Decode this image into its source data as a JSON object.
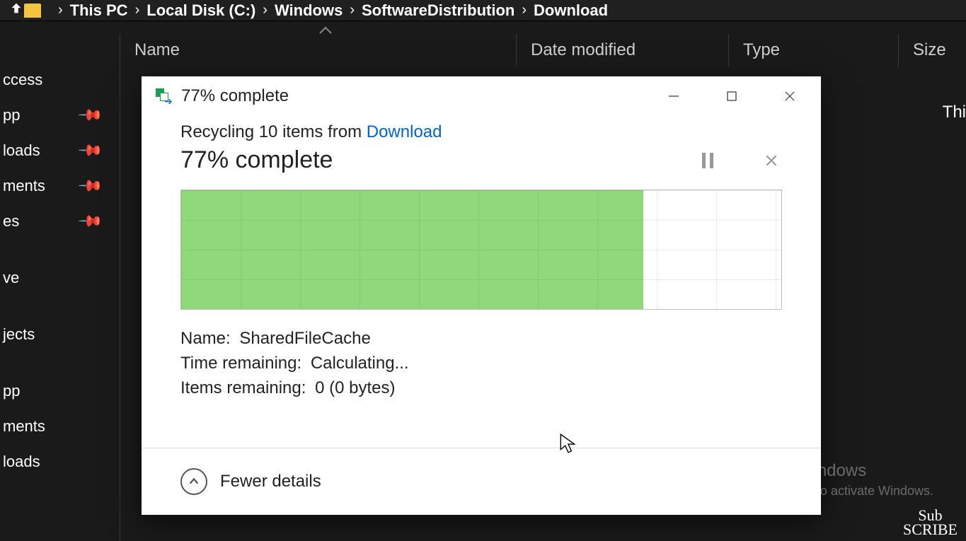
{
  "breadcrumb": {
    "items": [
      "This PC",
      "Local Disk (C:)",
      "Windows",
      "SoftwareDistribution",
      "Download"
    ]
  },
  "columns": {
    "name": "Name",
    "date": "Date modified",
    "type": "Type",
    "size": "Size"
  },
  "row_partial": "Thi",
  "sidebar": {
    "items": [
      {
        "label": "ccess",
        "pinned": false
      },
      {
        "label": "pp",
        "pinned": true
      },
      {
        "label": "loads",
        "pinned": true
      },
      {
        "label": "ments",
        "pinned": true
      },
      {
        "label": "es",
        "pinned": true
      }
    ],
    "items2": [
      {
        "label": "ve"
      },
      {
        "label": "jects"
      },
      {
        "label": "pp"
      },
      {
        "label": "ments"
      },
      {
        "label": "loads"
      }
    ]
  },
  "dialog": {
    "title": "77% complete",
    "op_prefix": "Recycling 10 items from ",
    "op_link": "Download",
    "percent_text": "77% complete",
    "percent_value": 77,
    "details": {
      "name_label": "Name:",
      "name_value": "SharedFileCache",
      "time_label": "Time remaining:",
      "time_value": "Calculating...",
      "items_label": "Items remaining:",
      "items_value": "0 (0 bytes)"
    },
    "footer_label": "Fewer details"
  },
  "watermark": {
    "line1": "Activate Windows",
    "line2": "Go to Settings to activate Windows."
  },
  "subscribe": {
    "l1": "Sub",
    "l2": "SCRIBE"
  },
  "colors": {
    "progress_fill": "#8fd97a",
    "link": "#0066cc",
    "bg_dark": "#1a1a1a"
  }
}
